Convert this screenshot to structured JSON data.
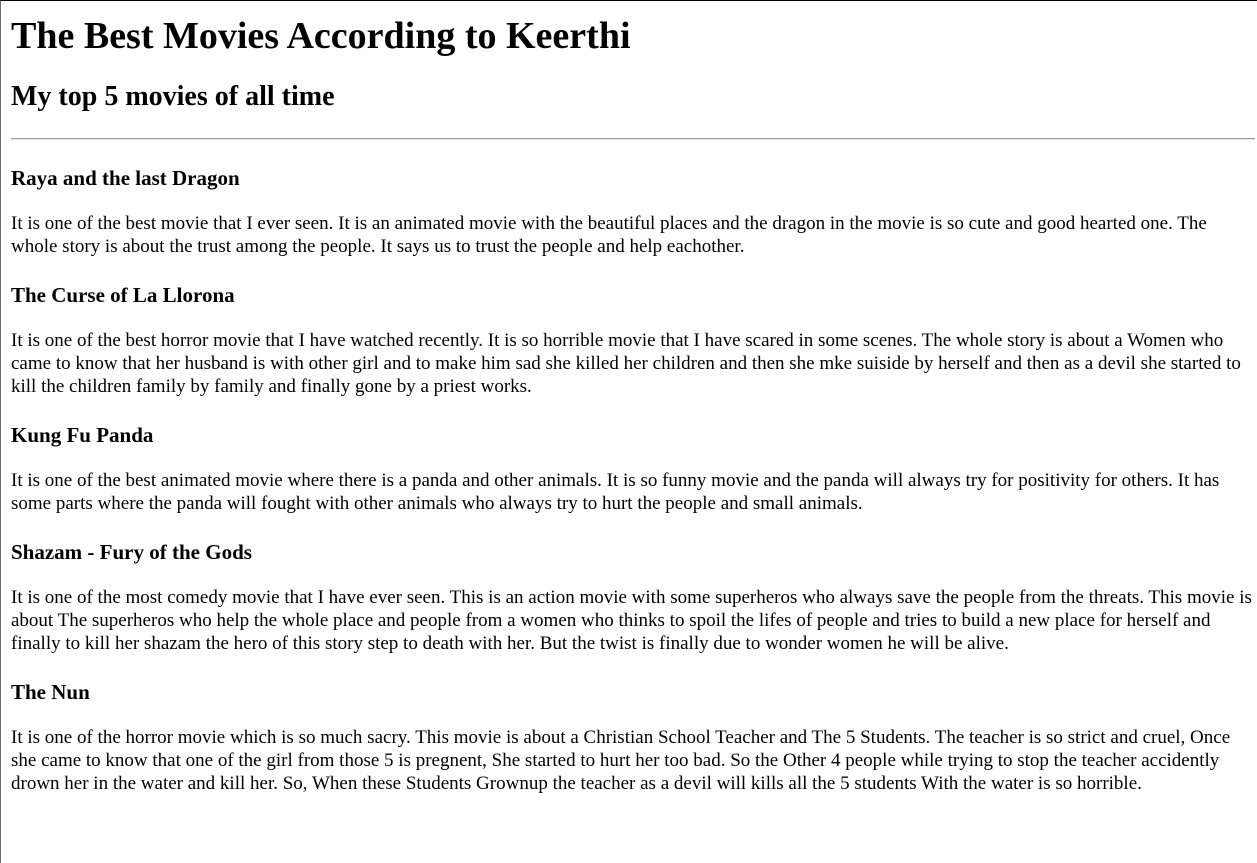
{
  "page": {
    "title": "The Best Movies According to Keerthi",
    "subtitle": "My top 5 movies of all time"
  },
  "movies": [
    {
      "title": "Raya and the last Dragon",
      "description": "It is one of the best movie that I ever seen. It is an animated movie with the beautiful places and the dragon in the movie is so cute and good hearted one. The whole story is about the trust among the people. It says us to trust the people and help eachother."
    },
    {
      "title": "The Curse of La Llorona",
      "description": "It is one of the best horror movie that I have watched recently. It is so horrible movie that I have scared in some scenes. The whole story is about a Women who came to know that her husband is with other girl and to make him sad she killed her children and then she mke suiside by herself and then as a devil she started to kill the children family by family and finally gone by a priest works."
    },
    {
      "title": "Kung Fu Panda",
      "description": "It is one of the best animated movie where there is a panda and other animals. It is so funny movie and the panda will always try for positivity for others. It has some parts where the panda will fought with other animals who always try to hurt the people and small animals."
    },
    {
      "title": "Shazam - Fury of the Gods",
      "description": "It is one of the most comedy movie that I have ever seen. This is an action movie with some superheros who always save the people from the threats. This movie is about The superheros who help the whole place and people from a women who thinks to spoil the lifes of people and tries to build a new place for herself and finally to kill her shazam the hero of this story step to death with her. But the twist is finally due to wonder women he will be alive."
    },
    {
      "title": "The Nun",
      "description": "It is one of the horror movie which is so much sacry. This movie is about a Christian School Teacher and The 5 Students. The teacher is so strict and cruel, Once she came to know that one of the girl from those 5 is pregnent, She started to hurt her too bad. So the Other 4 people while trying to stop the teacher accidently drown her in the water and kill her. So, When these Students Grownup the teacher as a devil will kills all the 5 students With the water is so horrible."
    }
  ]
}
